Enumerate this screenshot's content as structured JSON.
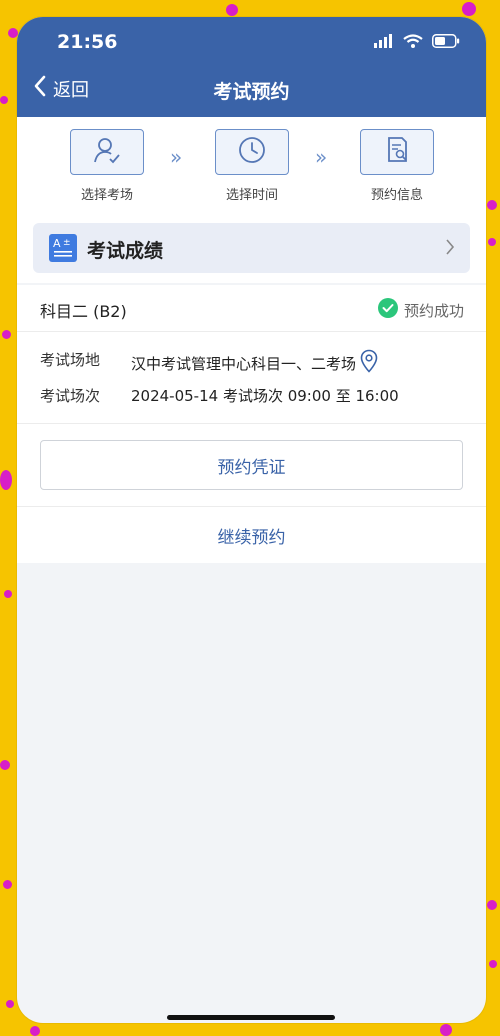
{
  "colors": {
    "brand": "#3a63a8",
    "accent": "#6b8fc9",
    "success": "#2bc67b",
    "background": "#f6c400"
  },
  "status_bar": {
    "time": "21:56",
    "icons": [
      "signal-icon",
      "wifi-icon",
      "battery-icon"
    ]
  },
  "navbar": {
    "back_label": "返回",
    "title": "考试预约"
  },
  "steps": [
    {
      "label": "选择考场",
      "icon": "person-check-icon"
    },
    {
      "label": "选择时间",
      "icon": "clock-icon"
    },
    {
      "label": "预约信息",
      "icon": "document-search-icon"
    }
  ],
  "score_card": {
    "title": "考试成绩",
    "icon": "grade-icon"
  },
  "result": {
    "subject": "科目二 (B2)",
    "status": "预约成功",
    "rows": [
      {
        "label": "考试场地",
        "value": "汉中考试管理中心科目一、二考场"
      },
      {
        "label": "考试场次",
        "value": "2024-05-14 考试场次 09:00 至 16:00"
      }
    ]
  },
  "actions": {
    "voucher": "预约凭证",
    "continue": "继续预约"
  }
}
